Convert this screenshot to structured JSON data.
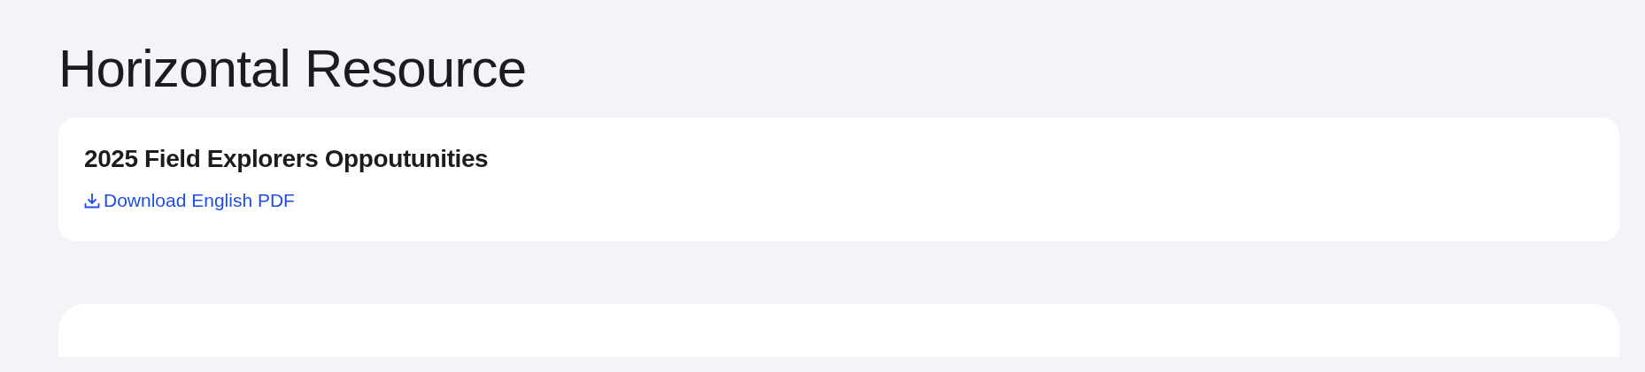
{
  "page_title": "Horizontal Resource",
  "resources": [
    {
      "title": "2025 Field Explorers Oppoutunities",
      "link": "Download English PDF"
    }
  ]
}
